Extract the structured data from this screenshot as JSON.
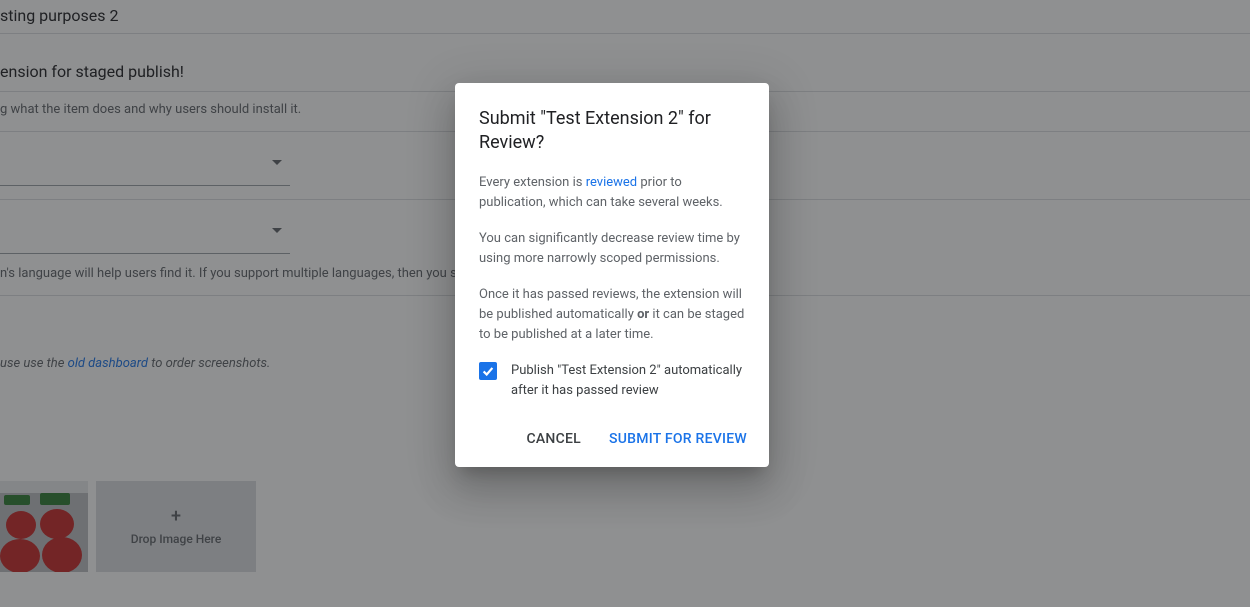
{
  "bg": {
    "name_value": "sting purposes 2",
    "summary_title": "ension for staged publish!",
    "summary_help": "g what the item does and why users should install it.",
    "lang_help": "n's language will help users find it. If you support multiple languages, then you sh",
    "ss_note_prefix": "use use the ",
    "ss_note_link": "old dashboard",
    "ss_note_suffix": " to order screenshots.",
    "drop_label": "Drop Image Here",
    "plus": "+"
  },
  "dialog": {
    "title": "Submit \"Test Extension 2\" for Review?",
    "p1_a": "Every extension is ",
    "p1_link": "reviewed",
    "p1_b": " prior to publication, which can take several weeks.",
    "p2": "You can significantly decrease review time by using more narrowly scoped permissions.",
    "p3_a": "Once it has passed reviews, the extension will be published automatically ",
    "p3_bold": "or",
    "p3_b": " it can be staged to be published at a later time.",
    "check_label": "Publish \"Test Extension 2\" automatically after it has passed review",
    "cancel": "CANCEL",
    "submit": "SUBMIT FOR REVIEW"
  }
}
